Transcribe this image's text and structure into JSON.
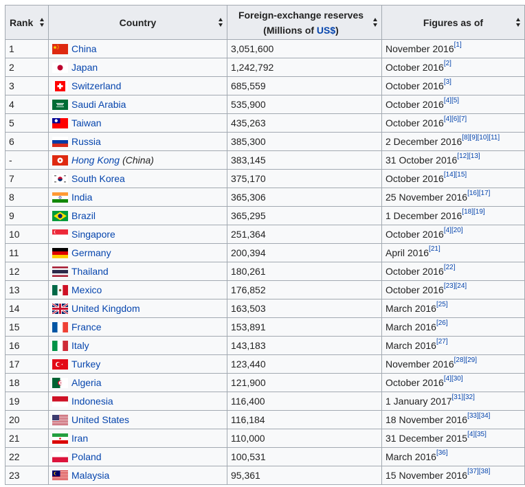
{
  "headers": {
    "rank": "Rank",
    "country": "Country",
    "reserves_line1": "Foreign-exchange reserves",
    "reserves_line2_pre": "(Millions of ",
    "reserves_currency": "US$",
    "reserves_line2_post": ")",
    "figures_as_of": "Figures as of"
  },
  "rows": [
    {
      "rank": "1",
      "country": "China",
      "flag": "china-flag-icon",
      "reserves": "3,051,600",
      "date": "November 2016",
      "refs": "[1]"
    },
    {
      "rank": "2",
      "country": "Japan",
      "flag": "japan-flag-icon",
      "reserves": "1,242,792",
      "date": "October 2016",
      "refs": "[2]"
    },
    {
      "rank": "3",
      "country": "Switzerland",
      "flag": "switzerland-flag-icon",
      "reserves": "685,559",
      "date": "October 2016",
      "refs": "[3]"
    },
    {
      "rank": "4",
      "country": "Saudi Arabia",
      "flag": "saudi-arabia-flag-icon",
      "reserves": "535,900",
      "date": "October 2016",
      "refs": "[4][5]"
    },
    {
      "rank": "5",
      "country": "Taiwan",
      "flag": "taiwan-flag-icon",
      "reserves": "435,263",
      "date": "October 2016",
      "refs": "[4][6][7]"
    },
    {
      "rank": "6",
      "country": "Russia",
      "flag": "russia-flag-icon",
      "reserves": "385,300",
      "date": "2 December 2016",
      "refs": "[8][9][10][11]"
    },
    {
      "rank": "-",
      "country": "Hong Kong",
      "country_suffix": "(China)",
      "italic": true,
      "flag": "hong-kong-flag-icon",
      "reserves": "383,145",
      "date": "31 October 2016",
      "refs": "[12][13]"
    },
    {
      "rank": "7",
      "country": "South Korea",
      "flag": "south-korea-flag-icon",
      "reserves": "375,170",
      "date": "October 2016",
      "refs": "[14][15]"
    },
    {
      "rank": "8",
      "country": "India",
      "flag": "india-flag-icon",
      "reserves": "365,306",
      "date": "25 November 2016",
      "refs": "[16][17]"
    },
    {
      "rank": "9",
      "country": "Brazil",
      "flag": "brazil-flag-icon",
      "reserves": "365,295",
      "date": "1 December 2016",
      "refs": "[18][19]"
    },
    {
      "rank": "10",
      "country": "Singapore",
      "flag": "singapore-flag-icon",
      "reserves": "251,364",
      "date": "October 2016",
      "refs": "[4][20]"
    },
    {
      "rank": "11",
      "country": "Germany",
      "flag": "germany-flag-icon",
      "reserves": "200,394",
      "date": "April 2016",
      "refs": "[21]"
    },
    {
      "rank": "12",
      "country": "Thailand",
      "flag": "thailand-flag-icon",
      "reserves": "180,261",
      "date": "October 2016",
      "refs": "[22]"
    },
    {
      "rank": "13",
      "country": "Mexico",
      "flag": "mexico-flag-icon",
      "reserves": "176,852",
      "date": "October 2016",
      "refs": "[23][24]"
    },
    {
      "rank": "14",
      "country": "United Kingdom",
      "flag": "united-kingdom-flag-icon",
      "reserves": "163,503",
      "date": "March 2016",
      "refs": "[25]"
    },
    {
      "rank": "15",
      "country": "France",
      "flag": "france-flag-icon",
      "reserves": "153,891",
      "date": "March 2016",
      "refs": "[26]"
    },
    {
      "rank": "16",
      "country": "Italy",
      "flag": "italy-flag-icon",
      "reserves": "143,183",
      "date": "March 2016",
      "refs": "[27]"
    },
    {
      "rank": "17",
      "country": "Turkey",
      "flag": "turkey-flag-icon",
      "reserves": "123,440",
      "date": "November 2016",
      "refs": "[28][29]"
    },
    {
      "rank": "18",
      "country": "Algeria",
      "flag": "algeria-flag-icon",
      "reserves": "121,900",
      "date": "October 2016",
      "refs": "[4][30]"
    },
    {
      "rank": "19",
      "country": "Indonesia",
      "flag": "indonesia-flag-icon",
      "reserves": "116,400",
      "date": "1 January 2017",
      "refs": "[31][32]"
    },
    {
      "rank": "20",
      "country": "United States",
      "flag": "united-states-flag-icon",
      "reserves": "116,184",
      "date": "18 November 2016",
      "refs": "[33][34]"
    },
    {
      "rank": "21",
      "country": "Iran",
      "flag": "iran-flag-icon",
      "reserves": "110,000",
      "date": "31 December 2015",
      "refs": "[4][35]"
    },
    {
      "rank": "22",
      "country": "Poland",
      "flag": "poland-flag-icon",
      "reserves": "100,531",
      "date": "March 2016",
      "refs": "[36]"
    },
    {
      "rank": "23",
      "country": "Malaysia",
      "flag": "malaysia-flag-icon",
      "reserves": "95,361",
      "date": "15 November 2016",
      "refs": "[37][38]"
    }
  ]
}
